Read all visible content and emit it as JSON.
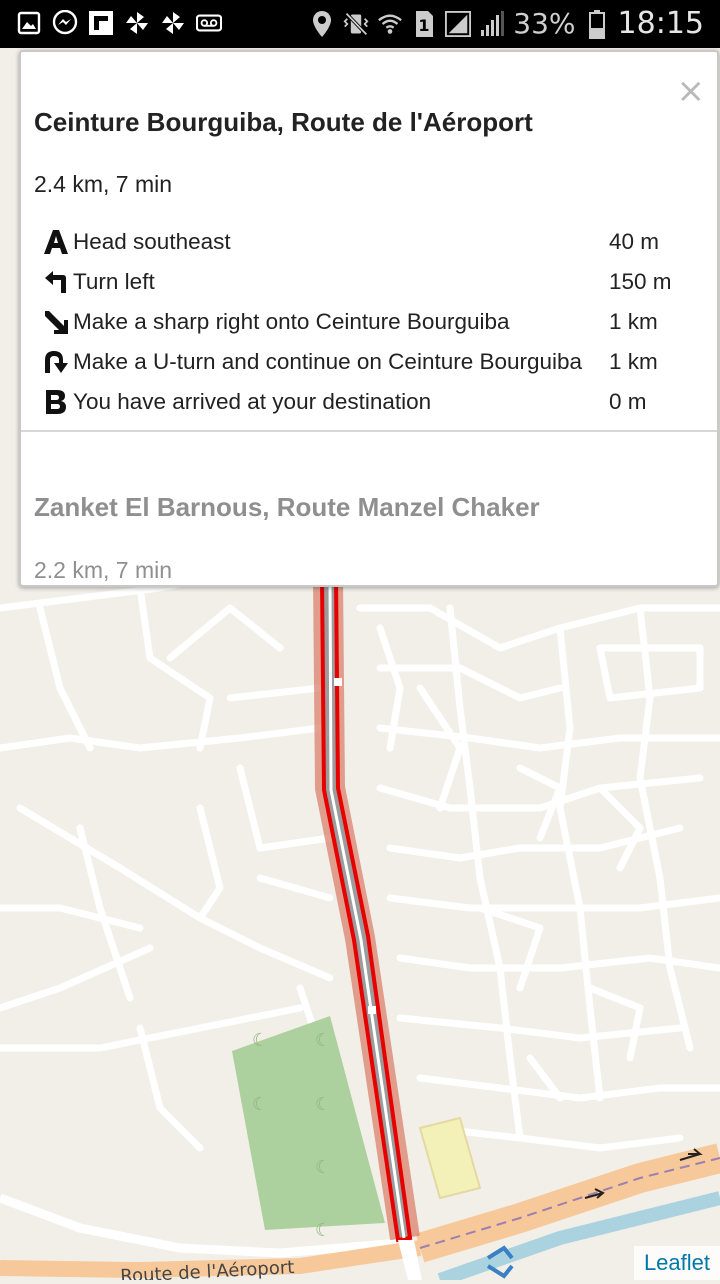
{
  "statusbar": {
    "battery_pct": "33%",
    "time": "18:15",
    "icons": [
      "gallery-icon",
      "messenger-icon",
      "flipboard-icon",
      "pinwheel-icon",
      "pinwheel-icon",
      "voicemail-icon",
      "location-icon",
      "vibrate-off-icon",
      "wifi-icon",
      "sim-1-icon",
      "signal-icon",
      "signal-icon",
      "battery-icon"
    ]
  },
  "map": {
    "road_label": "Route de l'Aéroport",
    "attribution": "Leaflet",
    "colors": {
      "background": "#f2efe9",
      "route": "#e60000",
      "road_halo": "#d9826c",
      "park": "#add19e",
      "water": "#aad3df"
    }
  },
  "panel": {
    "close_label": "×",
    "route1": {
      "title": "Ceinture Bourguiba, Route de l'Aéroport",
      "summary": "2.4 km, 7 min",
      "steps": [
        {
          "icon": "start-a-icon",
          "text": "Head southeast",
          "distance": "40 m"
        },
        {
          "icon": "turn-left-icon",
          "text": "Turn left",
          "distance": "150 m"
        },
        {
          "icon": "sharp-right-icon",
          "text": "Make a sharp right onto Ceinture Bourguiba",
          "distance": "1 km"
        },
        {
          "icon": "u-turn-icon",
          "text": "Make a U-turn and continue on Ceinture Bourguiba",
          "distance": "1 km"
        },
        {
          "icon": "end-b-icon",
          "text": "You have arrived at your destination",
          "distance": "0 m"
        }
      ]
    },
    "route2": {
      "title": "Zanket El Barnous, Route Manzel Chaker",
      "summary": "2.2 km, 7 min"
    }
  }
}
